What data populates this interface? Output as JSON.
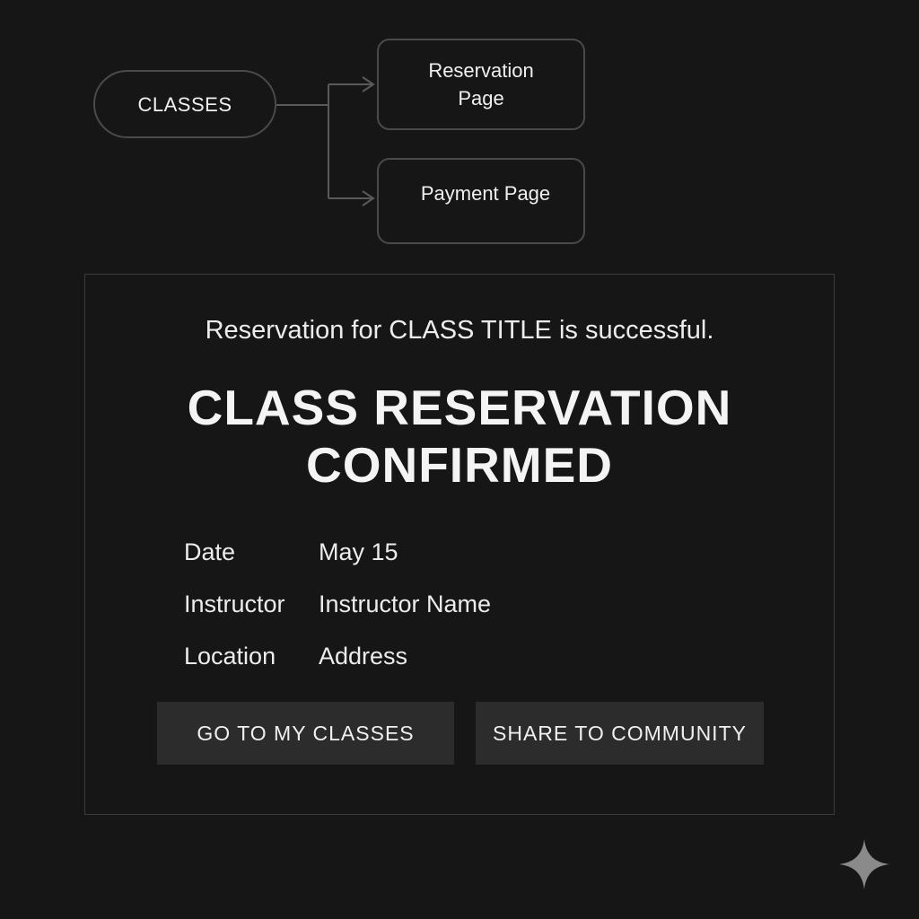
{
  "flow": {
    "classes_label": "CLASSES",
    "reservation_label": "Reservation Page",
    "payment_label": "Payment Page"
  },
  "card": {
    "success_message": "Reservation for CLASS TITLE is successful.",
    "title": "CLASS RESERVATION CONFIRMED",
    "details": [
      {
        "label": "Date",
        "value": "May 15"
      },
      {
        "label": "Instructor",
        "value": "Instructor Name"
      },
      {
        "label": "Location",
        "value": "Address"
      }
    ],
    "buttons": {
      "my_classes": "GO TO MY CLASSES",
      "share": "SHARE TO COMMUNITY"
    }
  },
  "icons": {
    "corner": "sparkle-icon"
  },
  "colors": {
    "background": "#161616",
    "button_bg": "#2c2c2c",
    "border": "#4a4a4a"
  }
}
